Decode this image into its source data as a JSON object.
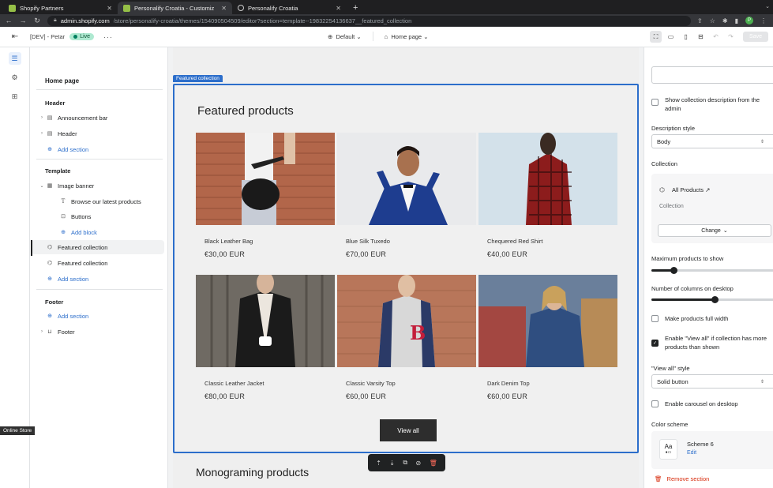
{
  "browser": {
    "tabs": [
      {
        "title": "Shopify Partners",
        "active": false
      },
      {
        "title": "Personalify Croatia - Customiz",
        "active": true
      },
      {
        "title": "Personalify Croatia",
        "active": false
      }
    ],
    "url_host": "admin.shopify.com",
    "url_path": "/store/personalify-croatia/themes/154090504509/editor?section=template--19832254136637__featured_collection"
  },
  "editor": {
    "store_label": "[DEV] - Petar",
    "status_badge": "Live",
    "more": "···",
    "theme_select": "Default",
    "page_select": "Home page",
    "save_label": "Save"
  },
  "sidebar": {
    "title": "Home page",
    "header_group": "Header",
    "header_items": [
      "Announcement bar",
      "Header"
    ],
    "add_section": "Add section",
    "template_group": "Template",
    "image_banner": "Image banner",
    "image_banner_blocks": [
      "Browse our latest products",
      "Buttons"
    ],
    "add_block": "Add block",
    "template_items": [
      "Featured collection",
      "Featured collection"
    ],
    "footer_group": "Footer",
    "footer_items": [
      "Footer"
    ],
    "online_store_tooltip": "Online Store"
  },
  "preview": {
    "section_label": "Featured collection",
    "section_title": "Featured products",
    "products": [
      {
        "name": "Black Leather Bag",
        "price": "€30,00 EUR"
      },
      {
        "name": "Blue Silk Tuxedo",
        "price": "€70,00 EUR"
      },
      {
        "name": "Chequered Red Shirt",
        "price": "€40,00 EUR"
      },
      {
        "name": "Classic Leather Jacket",
        "price": "€80,00 EUR"
      },
      {
        "name": "Classic Varsity Top",
        "price": "€60,00 EUR"
      },
      {
        "name": "Dark Denim Top",
        "price": "€60,00 EUR"
      }
    ],
    "view_all": "View all",
    "next_section_title": "Monograming products"
  },
  "settings": {
    "show_description_label": "Show collection description from the admin",
    "description_style_label": "Description style",
    "description_style_value": "Body",
    "collection_label": "Collection",
    "collection_name": "All Products",
    "collection_sub": "Collection",
    "change_label": "Change",
    "max_products_label": "Maximum products to show",
    "max_products_value": 6,
    "columns_label": "Number of columns on desktop",
    "columns_value": 3,
    "full_width_label": "Make products full width",
    "full_width_checked": false,
    "enable_view_all_label": "Enable \"View all\" if collection has more products than shown",
    "enable_view_all_checked": true,
    "view_all_style_label": "\"View all\" style",
    "view_all_style_value": "Solid button",
    "carousel_label": "Enable carousel on desktop",
    "carousel_checked": false,
    "color_scheme_label": "Color scheme",
    "scheme_aa": "Aa",
    "scheme_name": "Scheme 6",
    "scheme_edit": "Edit",
    "remove_section": "Remove section"
  }
}
